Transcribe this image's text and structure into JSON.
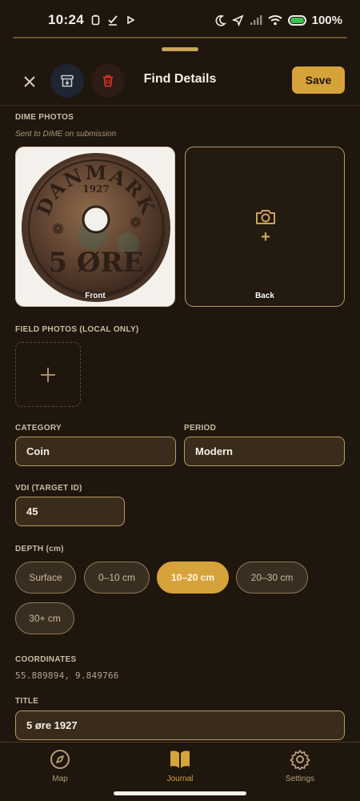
{
  "status": {
    "time": "10:24",
    "battery": "100%"
  },
  "header": {
    "title": "Find Details",
    "save_label": "Save",
    "icons": [
      "close-icon",
      "archive-icon",
      "trash-icon"
    ]
  },
  "dime": {
    "label": "DIME PHOTOS",
    "subtitle": "Sent to DIME on submission",
    "front_caption": "Front",
    "back_caption": "Back",
    "coin_text_top": "DANMARK",
    "coin_year": "1927",
    "coin_value": "5 ØRE"
  },
  "field_photos": {
    "label": "FIELD PHOTOS (LOCAL ONLY)"
  },
  "category": {
    "label": "CATEGORY",
    "value": "Coin"
  },
  "period": {
    "label": "PERIOD",
    "value": "Modern"
  },
  "vdi": {
    "label": "VDI (TARGET ID)",
    "value": "45"
  },
  "depth": {
    "label": "DEPTH (cm)",
    "options": [
      "Surface",
      "0–10 cm",
      "10–20 cm",
      "20–30 cm",
      "30+ cm"
    ],
    "selected": "10–20 cm"
  },
  "coordinates": {
    "label": "COORDINATES",
    "value": "55.889894, 9.849766"
  },
  "title_field": {
    "label": "TITLE",
    "value": "5 øre 1927"
  },
  "nav": {
    "items": [
      {
        "label": "Map",
        "icon": "compass-icon"
      },
      {
        "label": "Journal",
        "icon": "book-icon"
      },
      {
        "label": "Settings",
        "icon": "gear-icon"
      }
    ],
    "active": "Journal"
  },
  "colors": {
    "background": "#1f160e",
    "accent": "#d6a33a",
    "field": "#3a2c1c"
  }
}
